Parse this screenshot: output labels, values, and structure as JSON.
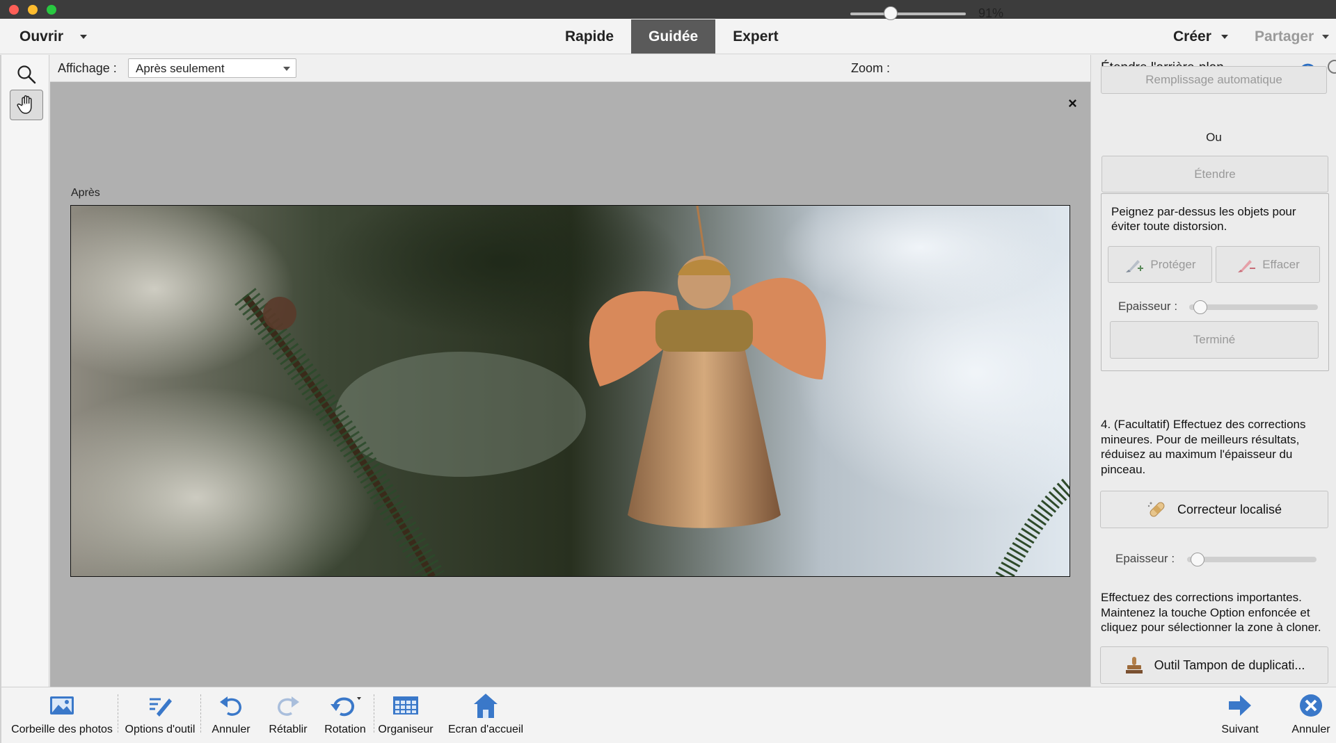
{
  "menubar": {
    "open_label": "Ouvrir",
    "modes": [
      "Rapide",
      "Guidée",
      "Expert"
    ],
    "active_mode": "Guidée",
    "create_label": "Créer",
    "share_label": "Partager"
  },
  "options": {
    "view_label": "Affichage :",
    "view_value": "Après seulement",
    "zoom_label": "Zoom :",
    "zoom_value": "91%",
    "zoom_fraction": 0.35
  },
  "canvas": {
    "close_symbol": "×",
    "after_label": "Après"
  },
  "panel": {
    "title": "Étendre l'arrière-plan",
    "auto_fill_label": "Remplissage automatique",
    "or_label": "Ou",
    "extend_label": "Étendre",
    "paint_hint": "Peignez par-dessus les objets pour éviter toute distorsion.",
    "protect_label": "Protéger",
    "erase_label": "Effacer",
    "thickness_label": "Epaisseur :",
    "done_label": "Terminé",
    "step4_text": "4. (Facultatif) Effectuez des corrections mineures. Pour de meilleurs résultats, réduisez au maximum l'épaisseur du pinceau.",
    "spot_healing_label": "Correcteur localisé",
    "thickness_label_2": "Epaisseur :",
    "major_text": "Effectuez des corrections importantes. Maintenez la touche Option enfoncée et cliquez pour sélectionner la zone à cloner.",
    "clone_stamp_label": "Outil Tampon de duplicati..."
  },
  "bottombar": {
    "photo_bin": "Corbeille des photos",
    "tool_options": "Options d'outil",
    "undo": "Annuler",
    "redo": "Rétablir",
    "rotate": "Rotation",
    "organizer": "Organiseur",
    "home": "Ecran d'accueil",
    "next": "Suivant",
    "cancel": "Annuler"
  },
  "colors": {
    "active_mode_bg": "#5a5a5a",
    "canvas_bg": "#b0b0b0",
    "icon_blue": "#3a78c9"
  }
}
